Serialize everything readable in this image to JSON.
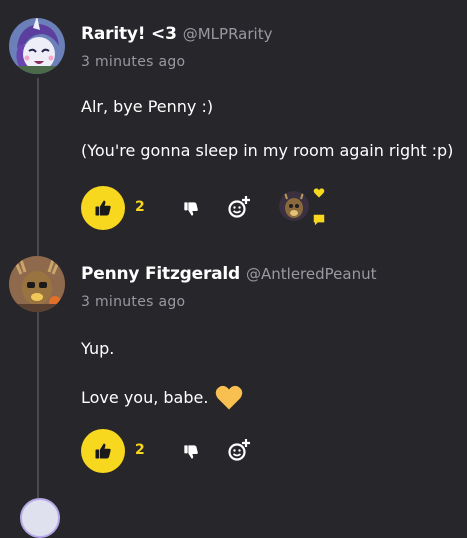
{
  "posts": [
    {
      "display_name": "Rarity! <3",
      "handle": "@MLPRarity",
      "time": "3 minutes ago",
      "lines": [
        "Alr, bye Penny :)",
        "(You're gonna sleep in my room again right :p)"
      ],
      "likes": "2"
    },
    {
      "display_name": "Penny Fitzgerald",
      "handle": "@AntleredPeanut",
      "time": "3 minutes ago",
      "lines": [
        "Yup.",
        "Love you, babe."
      ],
      "likes": "2"
    }
  ],
  "colors": {
    "background": "#27262b",
    "accent": "#f8d81e",
    "muted_text": "#9a99a0",
    "heart": "#f7c050"
  },
  "icons": [
    "thumbs-up-icon",
    "thumbs-down-icon",
    "add-reaction-icon",
    "heart-icon",
    "comment-icon"
  ]
}
